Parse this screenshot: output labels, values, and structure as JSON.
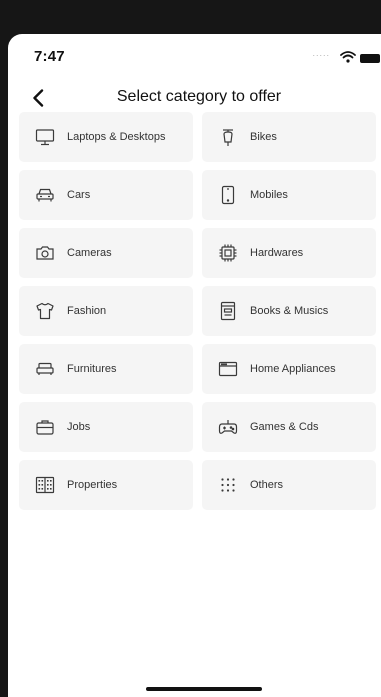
{
  "status_bar": {
    "time": "7:47",
    "signal": "....."
  },
  "header": {
    "title": "Select category to offer"
  },
  "categories": [
    {
      "label": "Laptops & Desktops",
      "icon": "monitor-icon"
    },
    {
      "label": "Bikes",
      "icon": "scooter-icon"
    },
    {
      "label": "Cars",
      "icon": "car-icon"
    },
    {
      "label": "Mobiles",
      "icon": "mobile-phone-icon"
    },
    {
      "label": "Cameras",
      "icon": "camera-icon"
    },
    {
      "label": "Hardwares",
      "icon": "chip-icon"
    },
    {
      "label": "Fashion",
      "icon": "tshirt-icon"
    },
    {
      "label": "Books & Musics",
      "icon": "book-icon"
    },
    {
      "label": "Furnitures",
      "icon": "sofa-icon"
    },
    {
      "label": "Home Appliances",
      "icon": "appliance-icon"
    },
    {
      "label": "Jobs",
      "icon": "briefcase-icon"
    },
    {
      "label": "Games & Cds",
      "icon": "gamepad-icon"
    },
    {
      "label": "Properties",
      "icon": "building-icon"
    },
    {
      "label": "Others",
      "icon": "dots-grid-icon"
    }
  ],
  "colors": {
    "tile_bg": "#f5f5f5",
    "icon_stroke": "#3a3a3a",
    "text": "#333333"
  }
}
